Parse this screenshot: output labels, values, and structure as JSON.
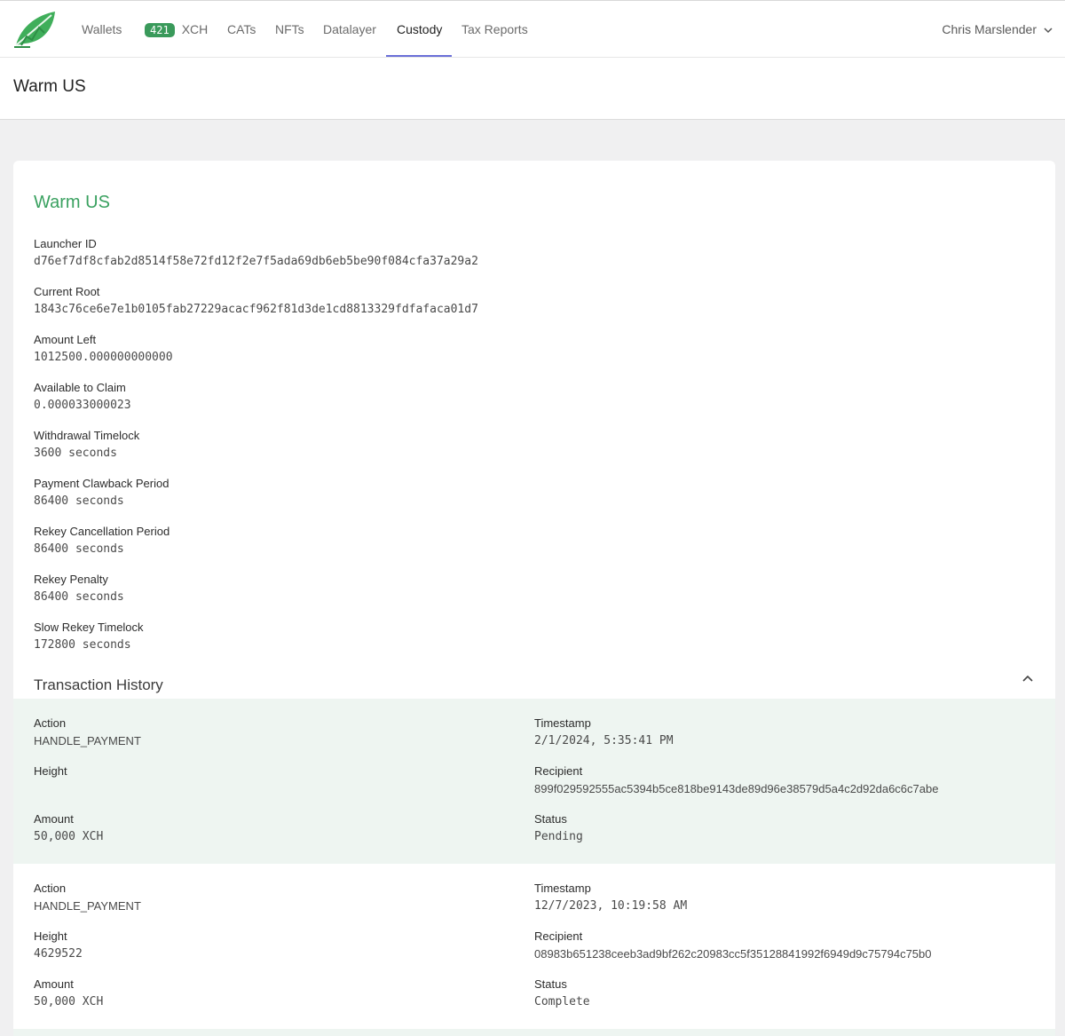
{
  "nav": {
    "items": [
      "Wallets",
      "XCH",
      "CATs",
      "NFTs",
      "Datalayer",
      "Custody",
      "Tax Reports"
    ],
    "xch_badge": "421",
    "active": "Custody",
    "user": "Chris Marslender"
  },
  "page_title": "Warm US",
  "vault": {
    "title": "Warm US",
    "fields": [
      {
        "label": "Launcher ID",
        "value": "d76ef7df8cfab2d8514f58e72fd12f2e7f5ada69db6eb5be90f084cfa37a29a2"
      },
      {
        "label": "Current Root",
        "value": "1843c76ce6e7e1b0105fab27229acacf962f81d3de1cd8813329fdfafaca01d7"
      },
      {
        "label": "Amount Left",
        "value": "1012500.000000000000"
      },
      {
        "label": "Available to Claim",
        "value": "0.000033000023"
      },
      {
        "label": "Withdrawal Timelock",
        "value": "3600 seconds"
      },
      {
        "label": "Payment Clawback Period",
        "value": "86400 seconds"
      },
      {
        "label": "Rekey Cancellation Period",
        "value": "86400 seconds"
      },
      {
        "label": "Rekey Penalty",
        "value": "86400 seconds"
      },
      {
        "label": "Slow Rekey Timelock",
        "value": "172800 seconds"
      }
    ]
  },
  "history": {
    "title": "Transaction History",
    "labels": {
      "action": "Action",
      "height": "Height",
      "amount": "Amount",
      "timestamp": "Timestamp",
      "recipient": "Recipient",
      "status": "Status"
    },
    "transactions": [
      {
        "action": "HANDLE_PAYMENT",
        "height": "",
        "amount": "50,000 XCH",
        "timestamp": "2/1/2024, 5:35:41 PM",
        "recipient": "899f029592555ac5394b5ce818be9143de89d96e38579d5a4c2d92da6c6c7abe",
        "status": "Pending"
      },
      {
        "action": "HANDLE_PAYMENT",
        "height": "4629522",
        "amount": "50,000 XCH",
        "timestamp": "12/7/2023, 10:19:58 AM",
        "recipient": "08983b651238ceeb3ad9bf262c20983cc5f35128841992f6949d9c75794c75b0",
        "status": "Complete"
      }
    ]
  }
}
